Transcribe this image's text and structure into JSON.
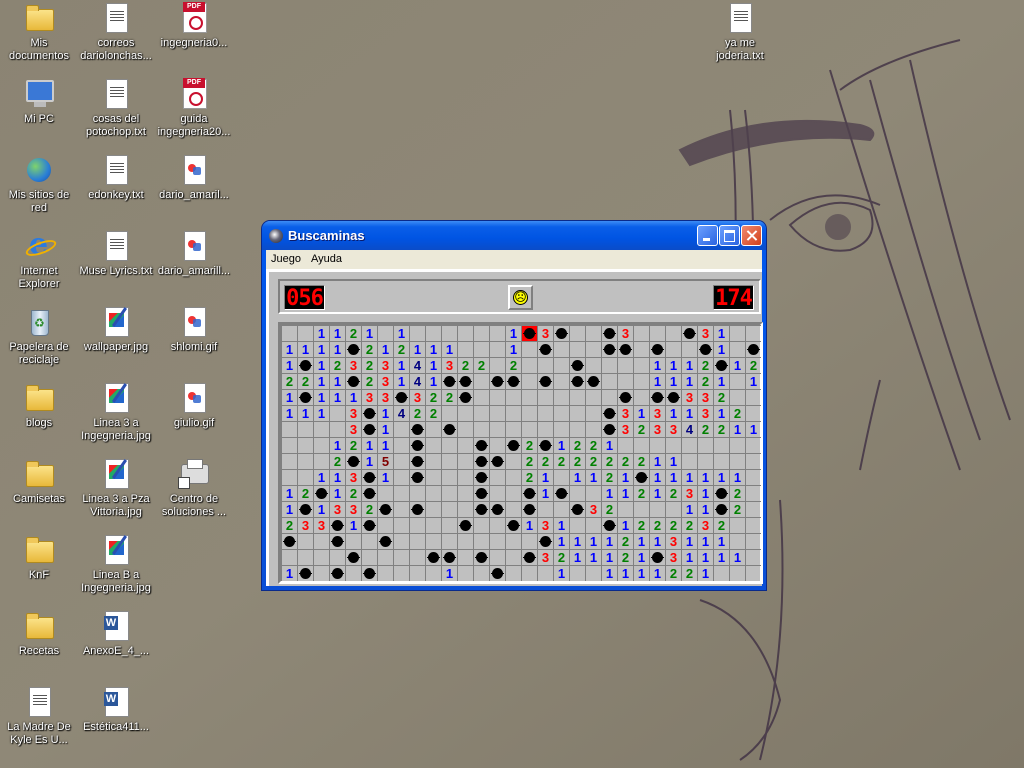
{
  "desktop": {
    "icons": [
      {
        "label": "Mis documentos",
        "kind": "folder"
      },
      {
        "label": "correos dariolonchas...",
        "kind": "txt"
      },
      {
        "label": "ingegneria0...",
        "kind": "pdf"
      },
      {
        "label": "ya me joderia.txt",
        "kind": "txt"
      },
      {
        "label": "Mi PC",
        "kind": "pc"
      },
      {
        "label": "cosas del potochop.txt",
        "kind": "txt"
      },
      {
        "label": "guida ingegneria20...",
        "kind": "pdf"
      },
      {
        "label": "Mis sitios de red",
        "kind": "net"
      },
      {
        "label": "edonkey.txt",
        "kind": "txt"
      },
      {
        "label": "dario_amaril...",
        "kind": "gif"
      },
      {
        "label": "Internet Explorer",
        "kind": "ie"
      },
      {
        "label": "Muse Lyrics.txt",
        "kind": "txt"
      },
      {
        "label": "dario_amarill...",
        "kind": "gif"
      },
      {
        "label": "Papelera de reciclaje",
        "kind": "bin"
      },
      {
        "label": "wallpaper.jpg",
        "kind": "jpg"
      },
      {
        "label": "shlomi.gif",
        "kind": "gif"
      },
      {
        "label": "blogs",
        "kind": "folder"
      },
      {
        "label": "Linea 3 a Ingegneria.jpg",
        "kind": "jpg"
      },
      {
        "label": "giulio.gif",
        "kind": "gif"
      },
      {
        "label": "Camisetas",
        "kind": "folder"
      },
      {
        "label": "Linea 3 a Pza Vittoria.jpg",
        "kind": "jpg"
      },
      {
        "label": "Centro de soluciones ...",
        "kind": "print"
      },
      {
        "label": "KnF",
        "kind": "folder"
      },
      {
        "label": "Linea B a Ingegneria.jpg",
        "kind": "jpg"
      },
      {
        "label": "Recetas",
        "kind": "folder"
      },
      {
        "label": "AnexoE_4_...",
        "kind": "word"
      },
      {
        "label": "La Madre De Kyle Es U...",
        "kind": "txt"
      },
      {
        "label": "Estética411...",
        "kind": "word"
      }
    ]
  },
  "window": {
    "title": "Buscaminas",
    "menu": {
      "juego": "Juego",
      "ayuda": "Ayuda"
    }
  },
  "game": {
    "mines_left": "056",
    "timer": "174",
    "face": "☹",
    "board": [
      "..1121.1......1*3*..*3...*31..",
      "1111*212111...1.*...**.*..*1.*",
      "1*12323141322.2...*....1112*12",
      "2211*23141**.**.*.**...11121.1",
      "1*11133*322*.........*.**332..",
      "111.3*1422..........*31311312.",
      "....3*1.*.*.........*3233422111",
      "...1211.*...*.*2*1221........",
      "...2*15.*...**.2222222211.....",
      "..113*1.*...*..21.1121*111111.",
      "12*12X......*..*1*..1121231*2.",
      "1*1332*.*...**.*..*32....11*2.",
      "233*1*.....*..*131..*1222232..",
      "*..*..*.........*11112113111.",
      "....*....**.*..*3211121*31111.",
      "1*.*.*....1..*...1..1111221..."
    ]
  },
  "colors": {
    "titlebar": "#0054e3",
    "n1": "#0000ff",
    "n2": "#008000",
    "n3": "#ff0000",
    "n4": "#000080",
    "n5": "#800000"
  }
}
